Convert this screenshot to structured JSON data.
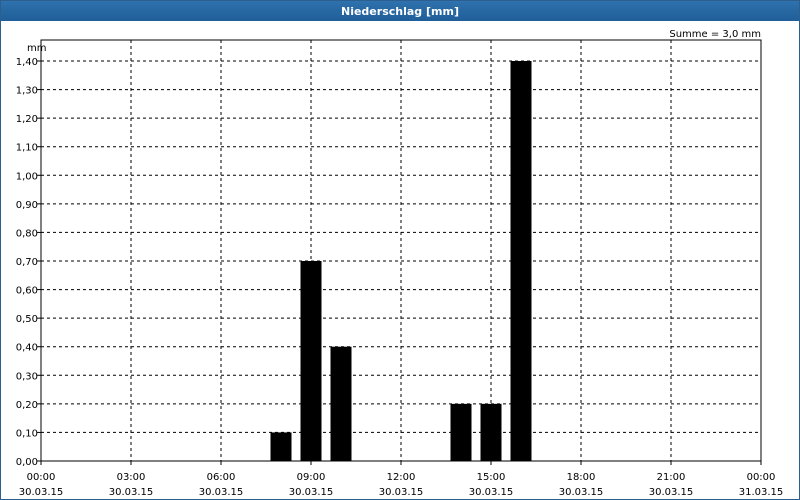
{
  "window": {
    "title": "Niederschlag [mm]"
  },
  "chart_data": {
    "type": "bar",
    "ylabel": "mm",
    "sum_label": "Summe = 3,0 mm",
    "ylim": [
      0,
      1.4
    ],
    "yticks": [
      "0,00",
      "0,10",
      "0,20",
      "0,30",
      "0,40",
      "0,50",
      "0,60",
      "0,70",
      "0,80",
      "0,90",
      "1,00",
      "1,10",
      "1,20",
      "1,30",
      "1,40"
    ],
    "xlim_hours": [
      0,
      24
    ],
    "xticks": [
      {
        "time": "00:00",
        "date": "30.03.15"
      },
      {
        "time": "03:00",
        "date": "30.03.15"
      },
      {
        "time": "06:00",
        "date": "30.03.15"
      },
      {
        "time": "09:00",
        "date": "30.03.15"
      },
      {
        "time": "12:00",
        "date": "30.03.15"
      },
      {
        "time": "15:00",
        "date": "30.03.15"
      },
      {
        "time": "18:00",
        "date": "30.03.15"
      },
      {
        "time": "21:00",
        "date": "30.03.15"
      },
      {
        "time": "00:00",
        "date": "31.03.15"
      }
    ],
    "bars": [
      {
        "time": "08:00",
        "value": 0.1
      },
      {
        "time": "09:00",
        "value": 0.7
      },
      {
        "time": "10:00",
        "value": 0.4
      },
      {
        "time": "14:00",
        "value": 0.2
      },
      {
        "time": "15:00",
        "value": 0.2
      },
      {
        "time": "16:00",
        "value": 1.4
      }
    ],
    "grid": true,
    "bar_color": "#000000"
  }
}
